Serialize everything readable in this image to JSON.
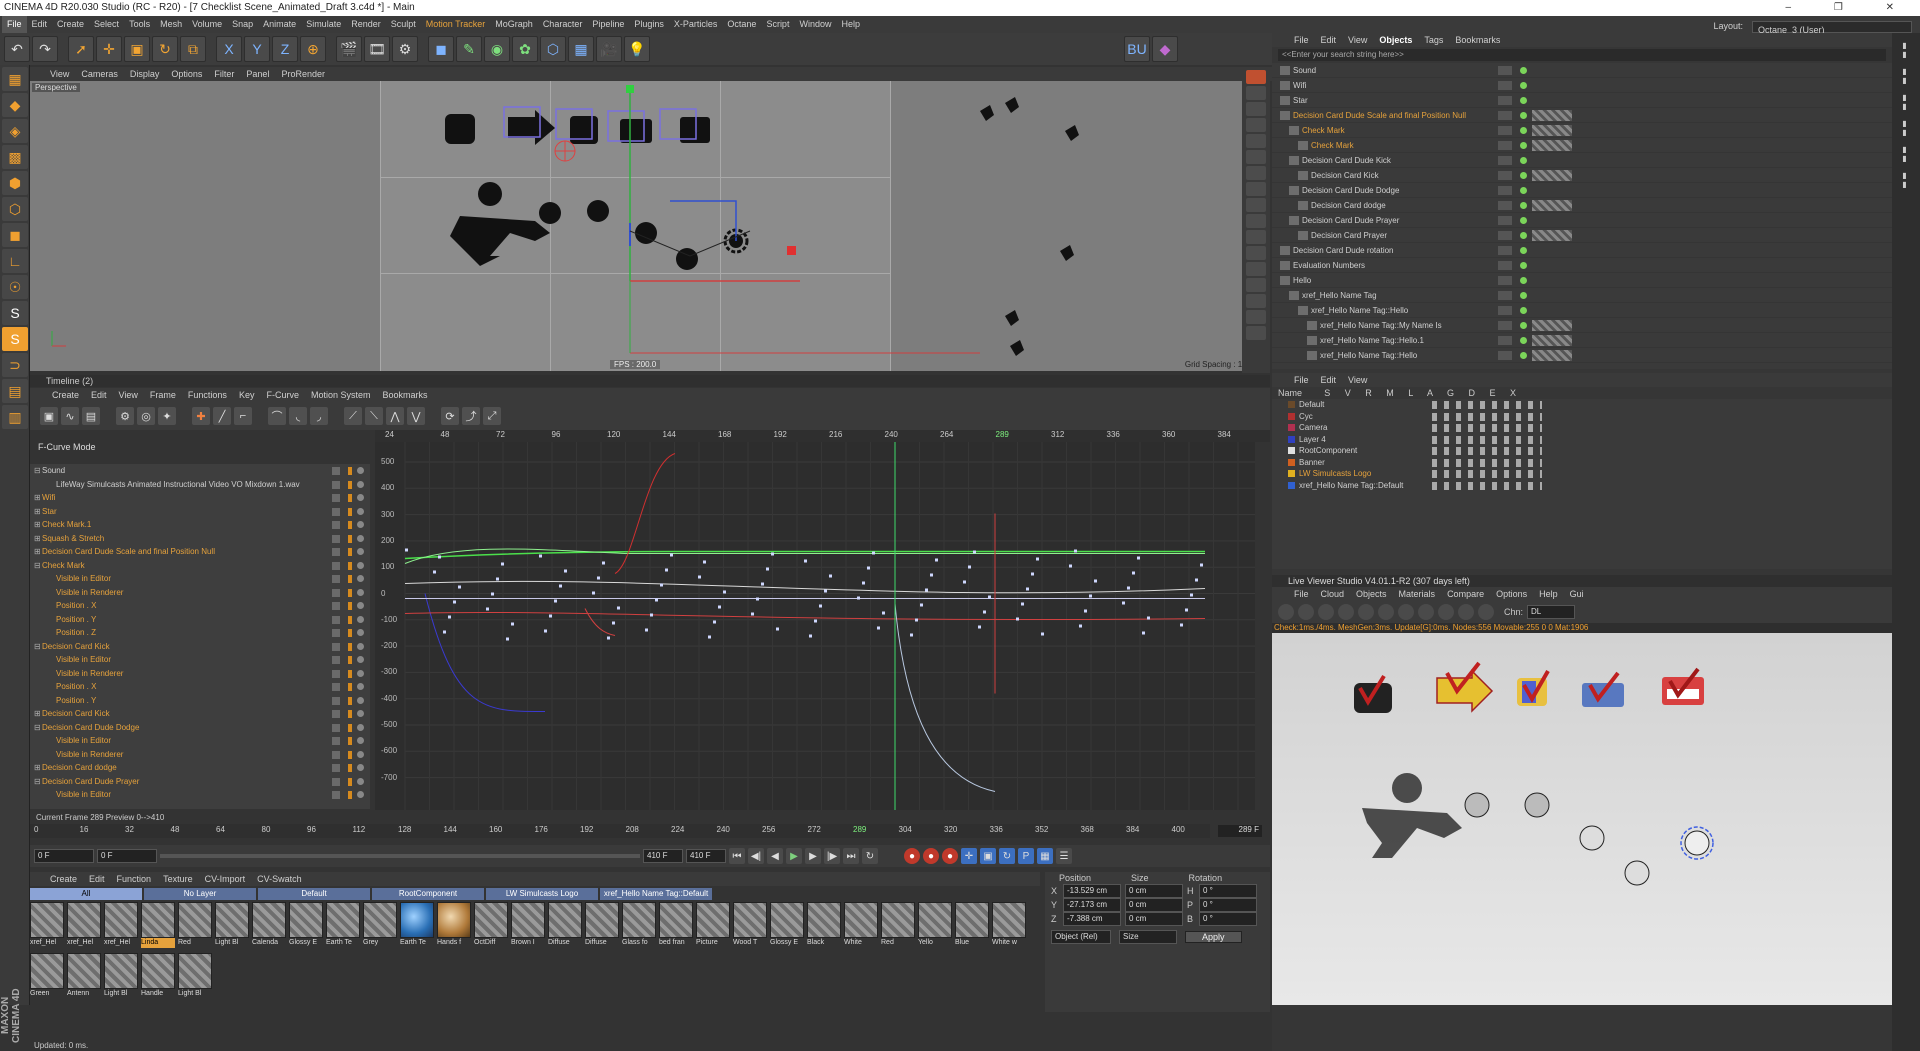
{
  "window": {
    "title": "CINEMA 4D R20.030 Studio (RC - R20) - [7 Checklist Scene_Animated_Draft 3.c4d *] - Main",
    "controls": "–  ❐  ✕"
  },
  "menubar": [
    "File",
    "Edit",
    "Create",
    "Select",
    "Tools",
    "Mesh",
    "Volume",
    "Snap",
    "Animate",
    "Simulate",
    "Render",
    "Sculpt",
    "Motion Tracker",
    "MoGraph",
    "Character",
    "Pipeline",
    "Plugins",
    "X-Particles",
    "Octane",
    "Script",
    "Window",
    "Help"
  ],
  "layout": {
    "label": "Layout:",
    "value": "Octane_3 (User)"
  },
  "viewport": {
    "menu": [
      "View",
      "Cameras",
      "Display",
      "Options",
      "Filter",
      "Panel",
      "ProRender"
    ],
    "label": "Perspective",
    "fps": "FPS : 200.0",
    "grid_spacing": "Grid Spacing : 100 cm"
  },
  "timeline": {
    "title": "Timeline (2)",
    "menu": [
      "Create",
      "Edit",
      "View",
      "Frame",
      "Functions",
      "Key",
      "F-Curve",
      "Motion System",
      "Bookmarks"
    ],
    "mode": "F-Curve Mode",
    "ruler": [
      "24",
      "48",
      "72",
      "96",
      "120",
      "144",
      "168",
      "192",
      "216",
      "240",
      "264",
      "289",
      "312",
      "336",
      "360",
      "384"
    ],
    "y_axis": [
      "500",
      "400",
      "300",
      "200",
      "100",
      "0",
      "-100",
      "-200",
      "-300",
      "-400",
      "-500",
      "-600",
      "-700"
    ],
    "tracks": [
      {
        "label": "Sound",
        "style": "w",
        "exp": "⊟"
      },
      {
        "label": "LifeWay Simulcasts Animated Instructional Video VO Mixdown 1.wav",
        "style": "w",
        "exp": ""
      },
      {
        "label": "Wifi",
        "style": "o",
        "exp": "⊞"
      },
      {
        "label": "Star",
        "style": "o",
        "exp": "⊞"
      },
      {
        "label": "Check Mark.1",
        "style": "o",
        "exp": "⊞"
      },
      {
        "label": "Squash & Stretch",
        "style": "o",
        "exp": "⊞"
      },
      {
        "label": "Decision Card Dude Scale and final Position Null",
        "style": "o",
        "exp": "⊞"
      },
      {
        "label": "Check Mark",
        "style": "o",
        "exp": "⊟"
      },
      {
        "label": "Visible in Editor",
        "style": "o",
        "exp": ""
      },
      {
        "label": "Visible in Renderer",
        "style": "o",
        "exp": ""
      },
      {
        "label": "Position . X",
        "style": "o",
        "exp": ""
      },
      {
        "label": "Position . Y",
        "style": "o",
        "exp": ""
      },
      {
        "label": "Position . Z",
        "style": "o",
        "exp": ""
      },
      {
        "label": "Decision Card Kick",
        "style": "o",
        "exp": "⊟"
      },
      {
        "label": "Visible in Editor",
        "style": "o",
        "exp": ""
      },
      {
        "label": "Visible in Renderer",
        "style": "o",
        "exp": ""
      },
      {
        "label": "Position . X",
        "style": "o",
        "exp": ""
      },
      {
        "label": "Position . Y",
        "style": "o",
        "exp": ""
      },
      {
        "label": "Decision Card Kick",
        "style": "o",
        "exp": "⊞"
      },
      {
        "label": "Decision Card Dude Dodge",
        "style": "o",
        "exp": "⊟"
      },
      {
        "label": "Visible in Editor",
        "style": "o",
        "exp": ""
      },
      {
        "label": "Visible in Renderer",
        "style": "o",
        "exp": ""
      },
      {
        "label": "Decision Card dodge",
        "style": "o",
        "exp": "⊞"
      },
      {
        "label": "Decision Card Dude Prayer",
        "style": "o",
        "exp": "⊟"
      },
      {
        "label": "Visible in Editor",
        "style": "o",
        "exp": ""
      }
    ],
    "current_frame": "Current Frame  289  Preview  0-->410",
    "frame_ruler": [
      "0",
      "16",
      "32",
      "48",
      "64",
      "80",
      "96",
      "112",
      "128",
      "144",
      "160",
      "176",
      "192",
      "208",
      "224",
      "240",
      "256",
      "272",
      "289",
      "304",
      "320",
      "336",
      "352",
      "368",
      "384",
      "400"
    ],
    "frame_indicator": "289 F",
    "start_field": "0 F",
    "start_field2": "0 F",
    "end_field": "410 F",
    "end_field2": "410 F"
  },
  "materials": {
    "menu": [
      "Create",
      "Edit",
      "Function",
      "Texture",
      "CV-Import",
      "CV-Swatch"
    ],
    "tabs": [
      "All",
      "No Layer",
      "Default",
      "RootComponent",
      "LW Simulcasts Logo",
      "xref_Hello Name Tag::Default"
    ],
    "items": [
      "xref_Hel",
      "xref_Hel",
      "xref_Hel",
      "Linda",
      "Red",
      "Light Bl",
      "Calenda",
      "Glossy E",
      "Earth Te",
      "Grey",
      "Earth Te",
      "Hands f",
      "OctDiff",
      "Brown I",
      "Diffuse",
      "Diffuse",
      "Glass fo",
      "bed fran",
      "Picture",
      "Wood T",
      "Glossy E",
      "Black",
      "White",
      "Red",
      "Yello",
      "Blue",
      "White w",
      "Green",
      "Antenn",
      "Light Bl",
      "Handle",
      "Light Bl"
    ]
  },
  "attributes": {
    "headers": [
      "Position",
      "Size",
      "Rotation"
    ],
    "rows": [
      {
        "axis": "X",
        "pos": "-13.529 cm",
        "size": "0 cm",
        "rk": "H",
        "rot": "0 °"
      },
      {
        "axis": "Y",
        "pos": "-27.173 cm",
        "size": "0 cm",
        "rk": "P",
        "rot": "0 °"
      },
      {
        "axis": "Z",
        "pos": "-7.388 cm",
        "size": "0 cm",
        "rk": "B",
        "rot": "0 °"
      }
    ],
    "mode1": "Object (Rel)",
    "mode2": "Size",
    "apply": "Apply"
  },
  "status": "Updated: 0 ms.",
  "brand": "MAXON CINEMA 4D",
  "objects": {
    "menu": [
      "File",
      "Edit",
      "View",
      "Objects",
      "Tags",
      "Bookmarks"
    ],
    "search_placeholder": "<<Enter your search string here>>",
    "items": [
      {
        "label": "Sound",
        "style": "w",
        "indent": 0
      },
      {
        "label": "Wifi",
        "style": "w",
        "indent": 0
      },
      {
        "label": "Star",
        "style": "w",
        "indent": 0
      },
      {
        "label": "Decision Card Dude Scale and final Position Null",
        "style": "o",
        "indent": 0
      },
      {
        "label": "Check Mark",
        "style": "o",
        "indent": 1
      },
      {
        "label": "Check Mark",
        "style": "o",
        "indent": 2
      },
      {
        "label": "Decision Card Dude Kick",
        "style": "w",
        "indent": 1
      },
      {
        "label": "Decision Card Kick",
        "style": "w",
        "indent": 2
      },
      {
        "label": "Decision Card Dude Dodge",
        "style": "w",
        "indent": 1
      },
      {
        "label": "Decision Card dodge",
        "style": "w",
        "indent": 2
      },
      {
        "label": "Decision Card Dude Prayer",
        "style": "w",
        "indent": 1
      },
      {
        "label": "Decision Card Prayer",
        "style": "w",
        "indent": 2
      },
      {
        "label": "Decision Card Dude rotation",
        "style": "w",
        "indent": 0
      },
      {
        "label": "Evaluation Numbers",
        "style": "w",
        "indent": 0
      },
      {
        "label": "Hello",
        "style": "w",
        "indent": 0
      },
      {
        "label": "xref_Hello Name Tag",
        "style": "w",
        "indent": 1
      },
      {
        "label": "xref_Hello Name Tag::Hello",
        "style": "w",
        "indent": 2
      },
      {
        "label": "xref_Hello Name Tag::My Name Is",
        "style": "w",
        "indent": 3
      },
      {
        "label": "xref_Hello Name Tag::Hello.1",
        "style": "w",
        "indent": 3
      },
      {
        "label": "xref_Hello Name Tag::Hello",
        "style": "w",
        "indent": 3
      }
    ]
  },
  "layers": {
    "menu": [
      "File",
      "Edit",
      "View"
    ],
    "header_name": "Name",
    "header_cols": "S V R M L A G D E X",
    "items": [
      {
        "label": "Default",
        "color": "#6a4a2a"
      },
      {
        "label": "Cyc",
        "color": "#b03030"
      },
      {
        "label": "Camera",
        "color": "#b03050"
      },
      {
        "label": "Layer 4",
        "color": "#3040c0"
      },
      {
        "label": "RootComponent",
        "color": "#e0e0e0"
      },
      {
        "label": "Banner",
        "color": "#d06020"
      },
      {
        "label": "LW Simulcasts Logo",
        "color": "#e0b020"
      },
      {
        "label": "xref_Hello Name Tag::Default",
        "color": "#3060d0"
      }
    ]
  },
  "liveviewer": {
    "title": "Live Viewer Studio V4.01.1-R2 (307 days left)",
    "menu": [
      "File",
      "Cloud",
      "Objects",
      "Materials",
      "Compare",
      "Options",
      "Help",
      "Gui"
    ],
    "channel_label": "Chn:",
    "channel_value": "DL",
    "stats": "Check:1ms./4ms. MeshGen:3ms. Update[G]:0ms. Nodes:556 Movable:255  0 0 Mat:1906"
  }
}
